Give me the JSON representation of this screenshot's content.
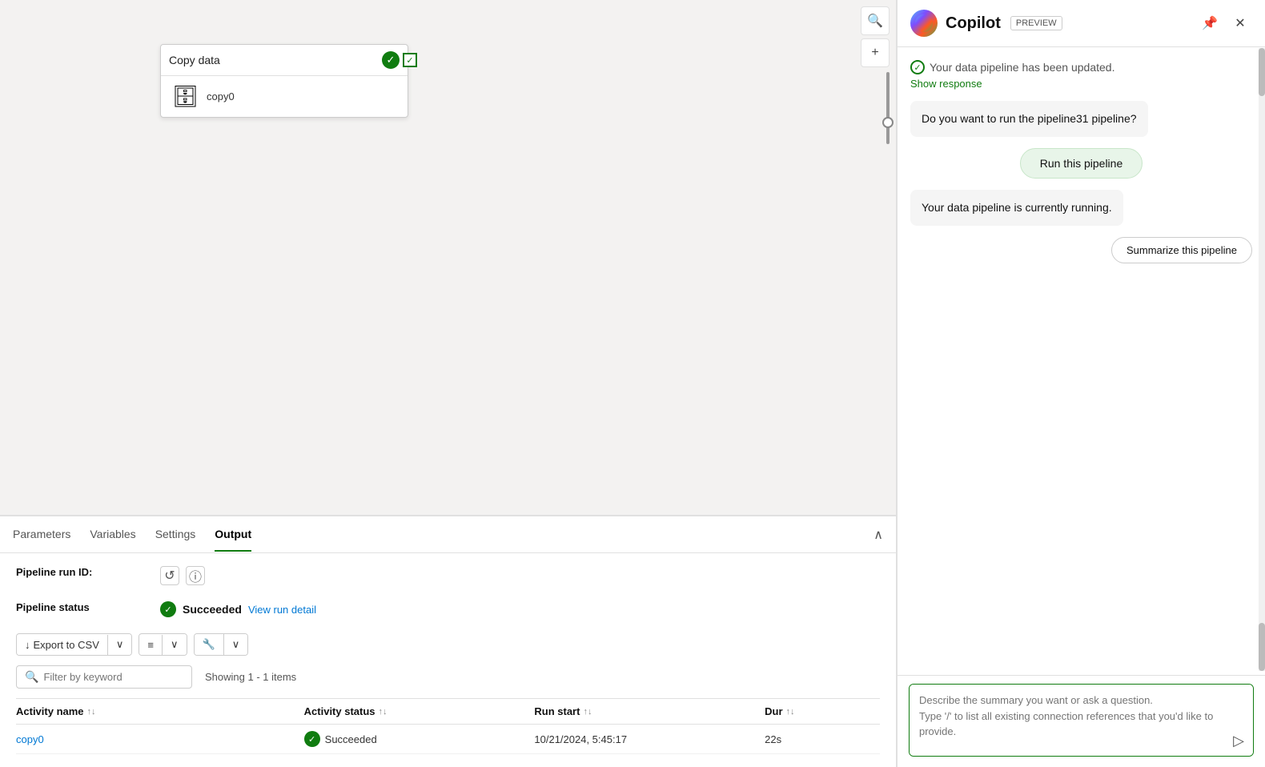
{
  "canvas": {
    "node_title": "Copy data",
    "node_body_label": "copy0",
    "zoom_plus": "+",
    "zoom_minus": "−",
    "search_icon": "🔍"
  },
  "tabs": {
    "items": [
      {
        "label": "Parameters",
        "active": false
      },
      {
        "label": "Variables",
        "active": false
      },
      {
        "label": "Settings",
        "active": false
      },
      {
        "label": "Output",
        "active": true
      }
    ],
    "collapse_label": "^"
  },
  "output": {
    "pipeline_run_id_label": "Pipeline run ID:",
    "pipeline_status_label": "Pipeline status",
    "status_value": "Succeeded",
    "view_run_detail_label": "View run detail",
    "export_csv_label": "Export to CSV",
    "filter_placeholder": "Filter by keyword",
    "showing_text": "Showing 1 - 1 items",
    "table_headers": [
      {
        "label": "Activity name",
        "sort": true
      },
      {
        "label": "Activity status",
        "sort": true
      },
      {
        "label": "Run start",
        "sort": true
      },
      {
        "label": "Dur",
        "sort": true
      }
    ],
    "table_rows": [
      {
        "activity_name": "copy0",
        "activity_status": "Succeeded",
        "run_start": "10/21/2024, 5:45:17",
        "duration": "22s"
      }
    ]
  },
  "copilot": {
    "title": "Copilot",
    "preview_label": "PREVIEW",
    "messages": [
      {
        "type": "system",
        "text": "Your data pipeline has been updated.",
        "show_response_label": "Show response"
      },
      {
        "type": "system",
        "text": "Do you want to run the pipeline31 pipeline?"
      },
      {
        "type": "action",
        "label": "Run this pipeline"
      },
      {
        "type": "system",
        "text": "Your data pipeline is currently running."
      }
    ],
    "summarize_btn_label": "Summarize this pipeline",
    "input_placeholder": "Describe the summary you want or ask a question.\nType '/' to list all existing connection references that you'd like to provide.",
    "send_icon": "▷"
  }
}
